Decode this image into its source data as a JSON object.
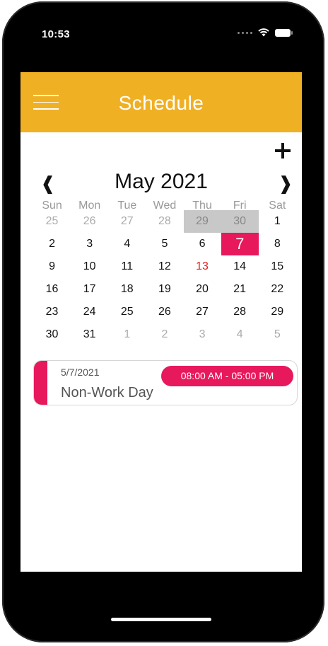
{
  "status_bar": {
    "time": "10:53"
  },
  "header": {
    "title": "Schedule"
  },
  "calendar": {
    "month_title": "May 2021",
    "prev_arrow": "❰",
    "next_arrow": "❱",
    "weekdays": [
      "Sun",
      "Mon",
      "Tue",
      "Wed",
      "Thu",
      "Fri",
      "Sat"
    ],
    "weeks": [
      [
        "25",
        "26",
        "27",
        "28",
        "29",
        "30",
        "1"
      ],
      [
        "2",
        "3",
        "4",
        "5",
        "6",
        "7",
        "8"
      ],
      [
        "9",
        "10",
        "11",
        "12",
        "13",
        "14",
        "15"
      ],
      [
        "16",
        "17",
        "18",
        "19",
        "20",
        "21",
        "22"
      ],
      [
        "23",
        "24",
        "25",
        "26",
        "27",
        "28",
        "29"
      ],
      [
        "30",
        "31",
        "1",
        "2",
        "3",
        "4",
        "5"
      ]
    ]
  },
  "event": {
    "date": "5/7/2021",
    "time_range": "08:00 AM - 05:00 PM",
    "title": "Non-Work Day"
  },
  "colors": {
    "header": "#f0b023",
    "accent": "#e8185c",
    "today": "#e02020"
  }
}
